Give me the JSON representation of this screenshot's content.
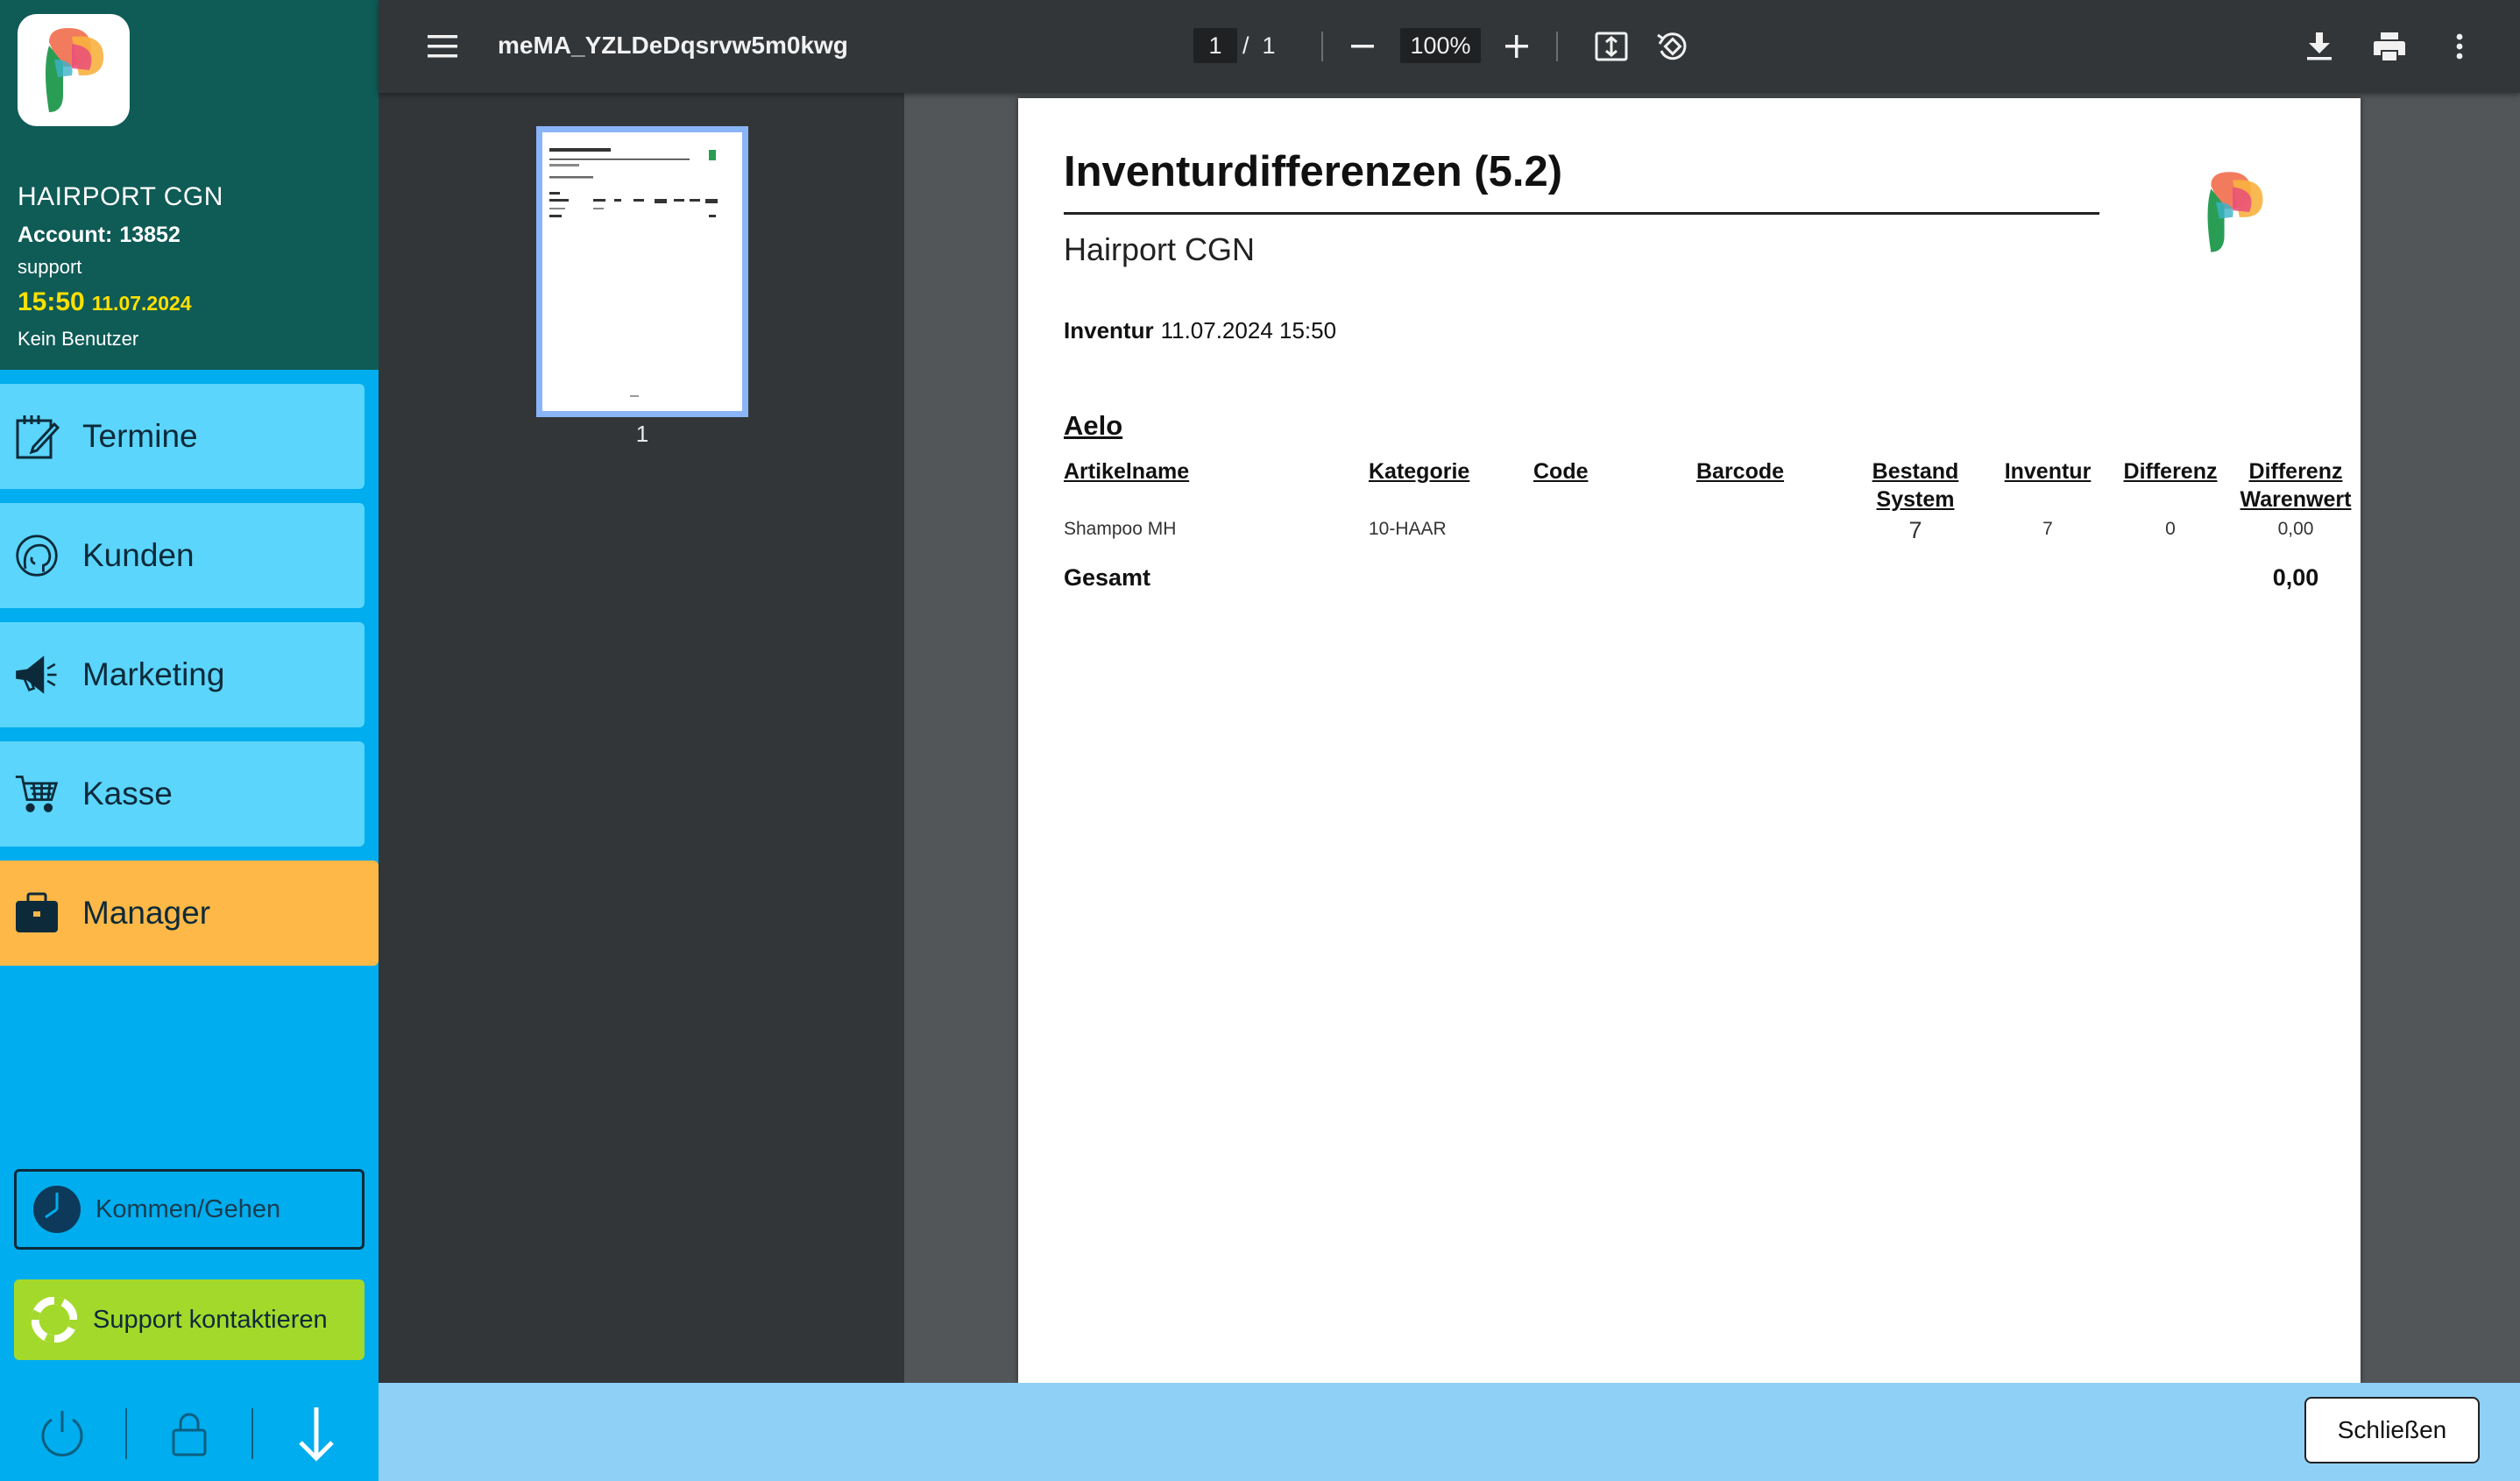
{
  "sidebar": {
    "salon_name": "HAIRPORT CGN",
    "account_label": "Account:",
    "account_number": "13852",
    "user": "support",
    "time": "15:50",
    "date": "11.07.2024",
    "user_status": "Kein Benutzer",
    "nav": [
      {
        "label": "Termine",
        "icon": "calendar-edit-icon"
      },
      {
        "label": "Kunden",
        "icon": "customer-head-icon"
      },
      {
        "label": "Marketing",
        "icon": "megaphone-icon"
      },
      {
        "label": "Kasse",
        "icon": "shopping-cart-icon"
      },
      {
        "label": "Manager",
        "icon": "briefcase-icon",
        "active": true
      }
    ],
    "kommen_gehen": "Kommen/Gehen",
    "support": "Support kontaktieren",
    "bottom_icons": [
      "power-icon",
      "lock-icon",
      "arrow-down-icon"
    ]
  },
  "viewer": {
    "filename": "meMA_YZLDeDqsrvw5m0kwg",
    "current_page": "1",
    "page_sep": "/",
    "total_pages": "1",
    "zoom": "100%",
    "thumbnail_number": "1"
  },
  "document": {
    "title": "Inventurdifferenzen (5.2)",
    "salon": "Hairport CGN",
    "inventur_label": "Inventur",
    "inventur_date": "11.07.2024 15:50",
    "vendor": "Aelo",
    "columns": {
      "artikelname": "Artikelname",
      "kategorie": "Kategorie",
      "code": "Code",
      "barcode": "Barcode",
      "bestand": "Bestand System",
      "inventur": "Inventur",
      "differenz": "Differenz",
      "warenwert": "Differenz Warenwert"
    },
    "row": {
      "artikelname": "Shampoo MH",
      "kategorie": "10-HAAR",
      "code": "",
      "barcode": "",
      "bestand": "7",
      "inventur": "7",
      "differenz": "0",
      "warenwert": "0,00"
    },
    "total_label": "Gesamt",
    "total_value": "0,00"
  },
  "footer": {
    "close": "Schließen"
  },
  "colors": {
    "sidebar_header": "#0f5b56",
    "sidebar_bg": "#00adee",
    "nav_item": "#5bd5fb",
    "nav_active": "#fdb847",
    "support_btn": "#a3d92b",
    "time_color": "#ffe000",
    "toolbar": "#323639",
    "viewer_bg": "#525659",
    "footer": "#8fd0f6"
  }
}
